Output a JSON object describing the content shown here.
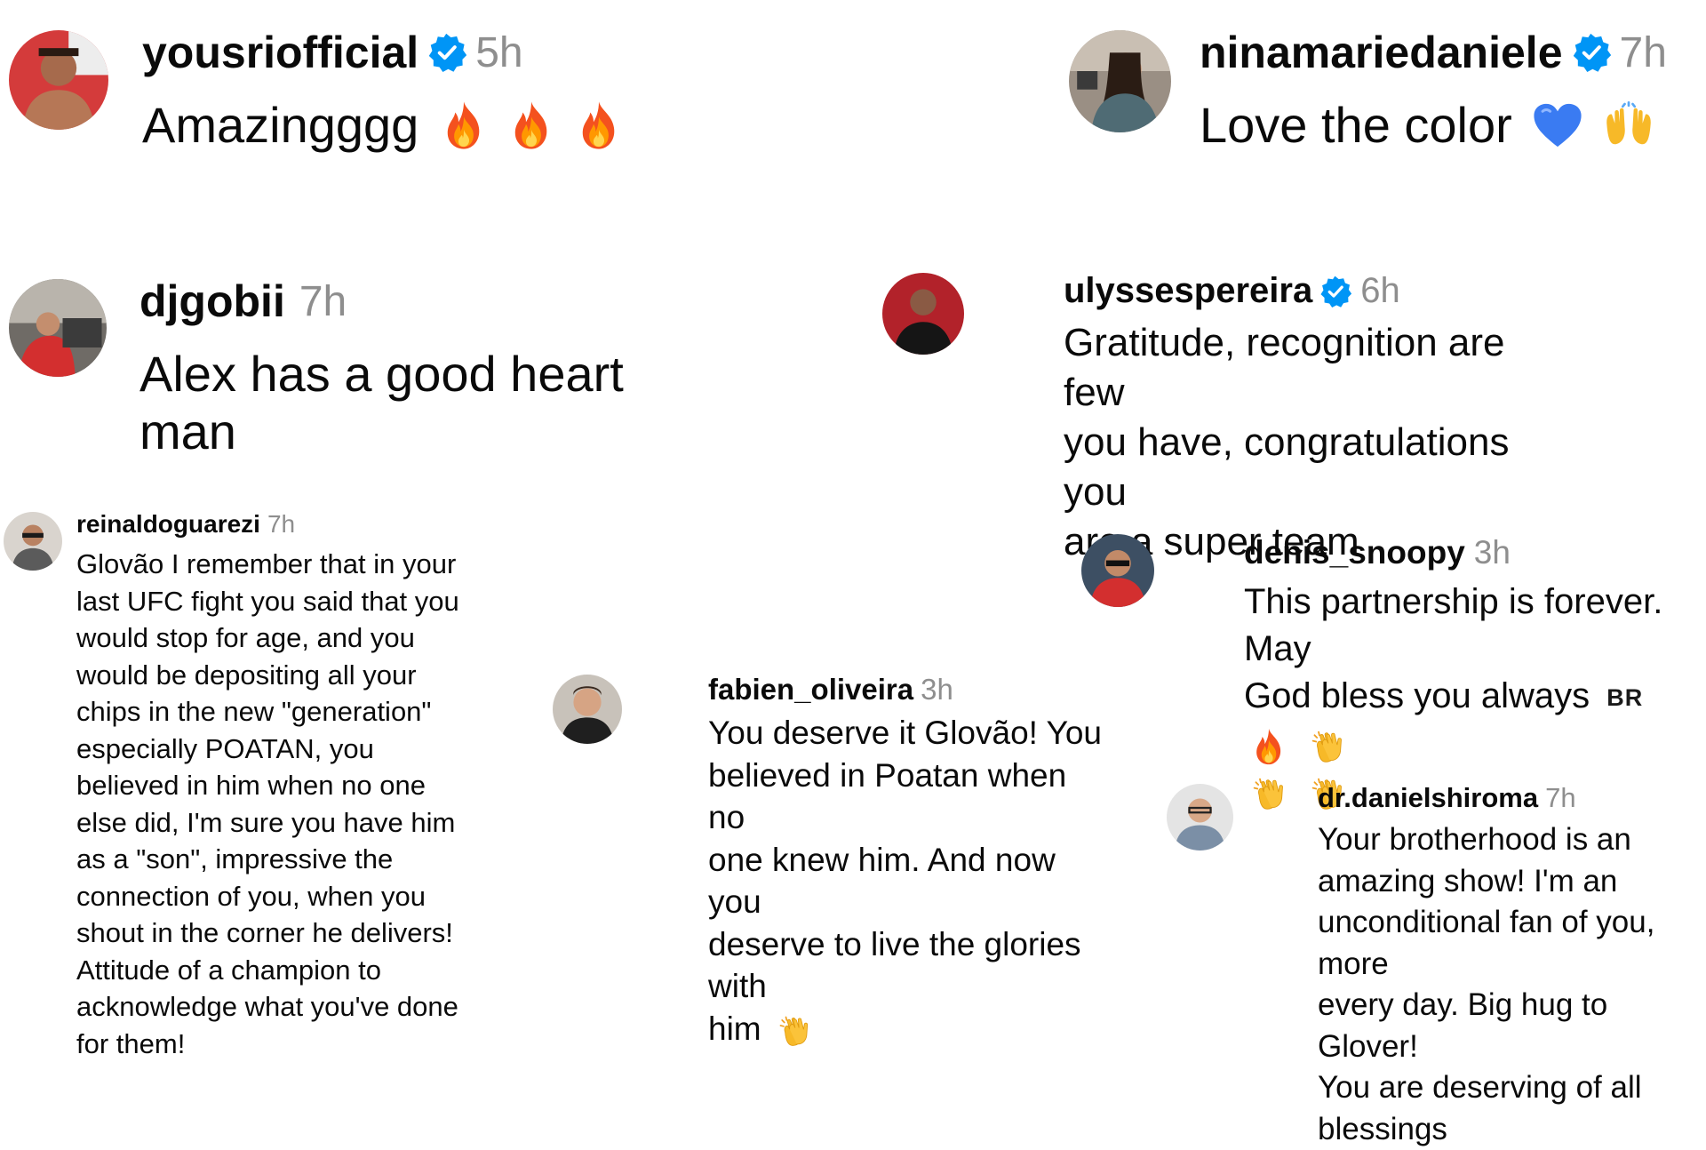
{
  "comments": [
    {
      "username": "yousriofficial",
      "verified": true,
      "time": "5h",
      "text": "Amazingggg",
      "emojis": [
        "fire-emoji",
        "fire-emoji",
        "fire-emoji"
      ]
    },
    {
      "username": "ninamariedaniele",
      "verified": true,
      "time": "7h",
      "text": "Love the color",
      "emojis": [
        "blue-heart-emoji",
        "raising-hands-emoji"
      ]
    },
    {
      "username": "djgobii",
      "verified": false,
      "time": "7h",
      "text": "Alex has a good heart man",
      "emojis": []
    },
    {
      "username": "ulyssespereira",
      "verified": true,
      "time": "6h",
      "text_lines": [
        "Gratitude, recognition are few",
        "you have, congratulations you",
        "are a super team"
      ],
      "emojis": []
    },
    {
      "username": "reinaldoguarezi",
      "verified": false,
      "time": "7h",
      "text_lines": [
        "Glovão I remember that in your",
        "last UFC fight you said that you",
        "would stop for age, and you",
        "would be depositing all your",
        "chips in the new \"generation\"",
        "especially POATAN, you",
        "believed in him when no one",
        "else did, I'm sure you have him",
        "as a \"son\", impressive the",
        "connection of you, when you",
        "shout in the corner he delivers!",
        "Attitude of a champion to",
        "acknowledge what you've done",
        "for them!"
      ],
      "emojis": []
    },
    {
      "username": "fabien_oliveira",
      "verified": false,
      "time": "3h",
      "text_lines": [
        "You deserve it Glovão! You",
        "believed in Poatan when no",
        "one knew him. And now you",
        "deserve to live the glories with",
        "him"
      ],
      "emojis": [
        "clapping-hands-emoji"
      ]
    },
    {
      "username": "denis_snoopy",
      "verified": false,
      "time": "3h",
      "text_lines": [
        "This partnership is forever. May",
        "God bless you always"
      ],
      "flag_text": "BR",
      "emojis": [
        "fire-emoji",
        "clapping-hands-emoji",
        "clapping-hands-emoji",
        "clapping-hands-emoji"
      ]
    },
    {
      "username": "dr.danielshiroma",
      "verified": false,
      "time": "7h",
      "text_lines": [
        "Your brotherhood is an",
        "amazing show! I'm an",
        "unconditional fan of you, more",
        "every day. Big hug to Glover!",
        "You are deserving of all",
        "blessings"
      ],
      "emojis": []
    }
  ],
  "colors": {
    "text": "#0a0a0a",
    "timestamp": "#8e8e8e",
    "verified_badge": "#0095f6"
  }
}
